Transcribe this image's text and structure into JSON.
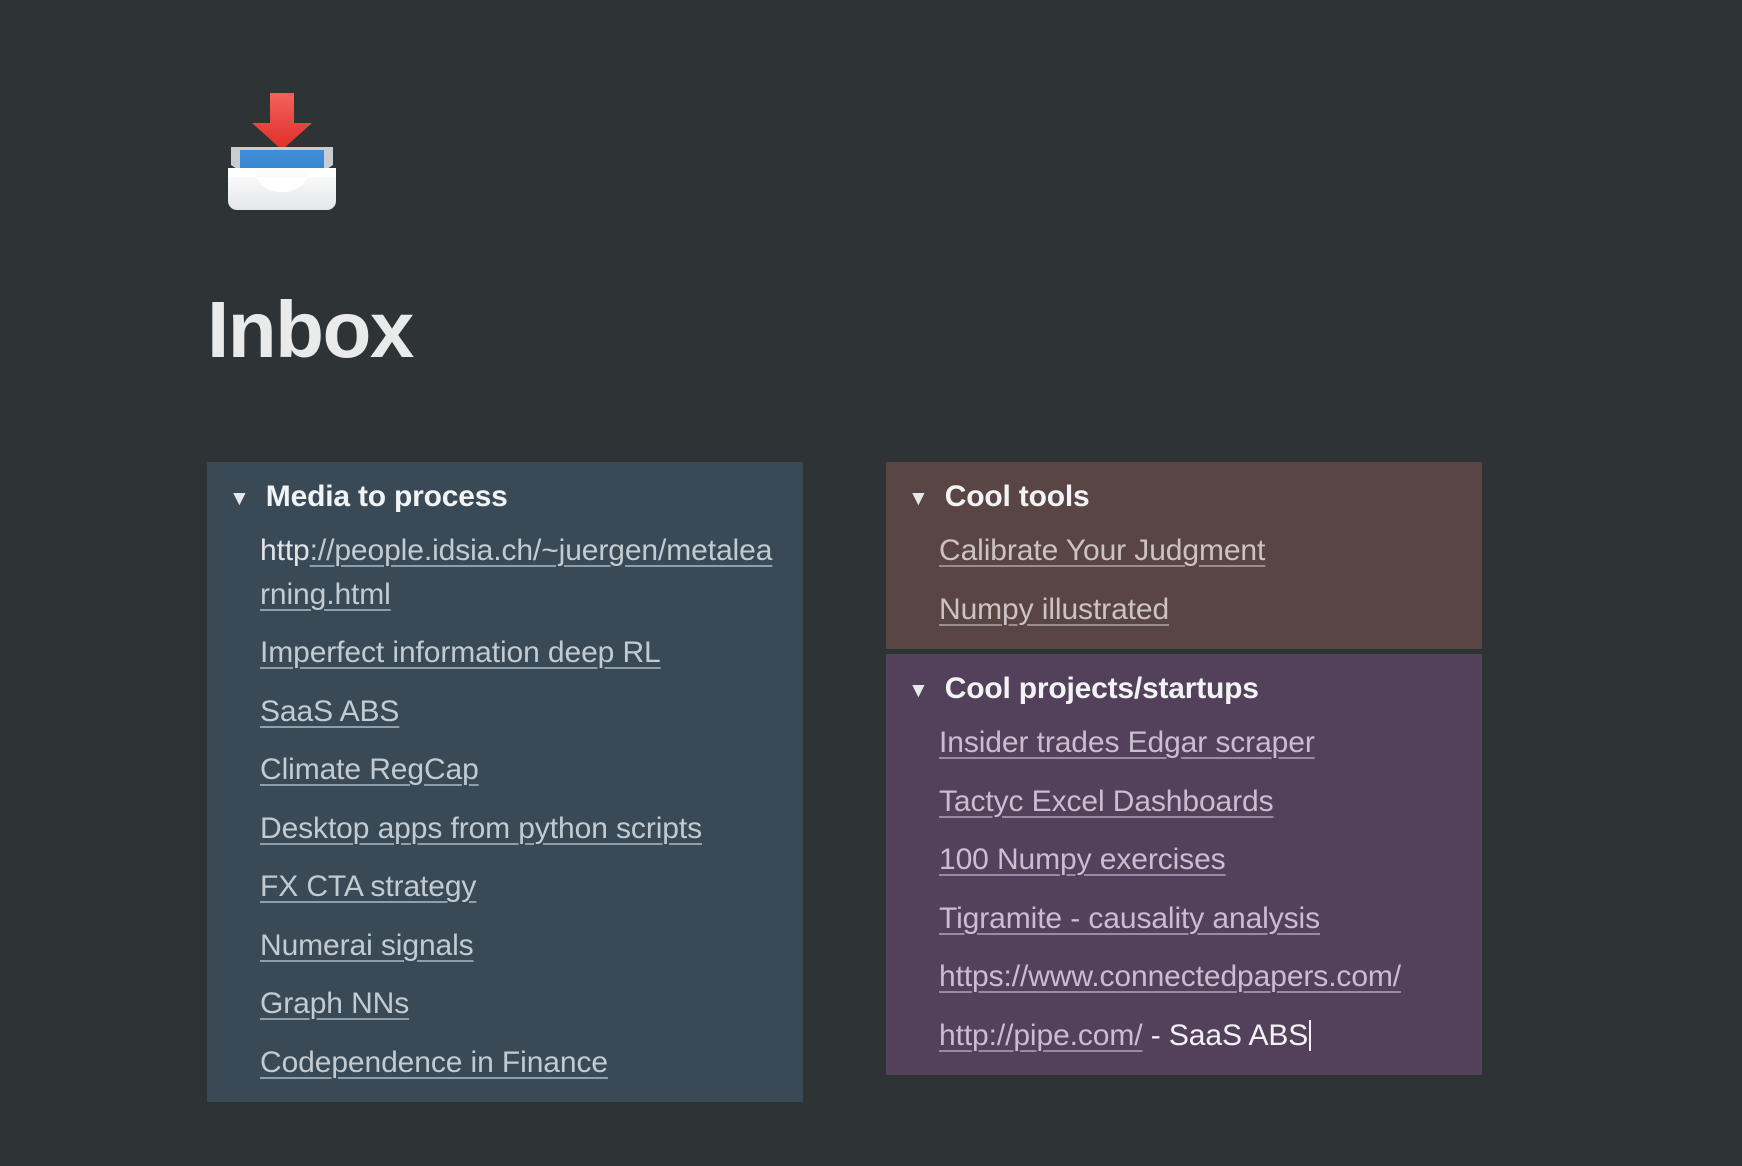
{
  "app": {
    "background_color": "#2e3336",
    "title": "Inbox",
    "icon": "inbox-tray-emoji",
    "icon_glyph": "📥"
  },
  "columns": [
    {
      "id": "left-column",
      "panels": [
        {
          "id": "media-to-process",
          "title": "Media to process",
          "twisty": "▼",
          "expanded": true,
          "color": "#394a56",
          "items": [
            {
              "prefix": "http",
              "link": "://people.idsia.ch/~juergen/metalearning.html",
              "tail": ""
            },
            {
              "prefix": "",
              "link": "Imperfect information deep RL",
              "tail": ""
            },
            {
              "prefix": "",
              "link": "SaaS ABS",
              "tail": ""
            },
            {
              "prefix": "",
              "link": "Climate RegCap",
              "tail": ""
            },
            {
              "prefix": "",
              "link": "Desktop apps from python scripts",
              "tail": ""
            },
            {
              "prefix": "",
              "link": "FX CTA strategy",
              "tail": ""
            },
            {
              "prefix": "",
              "link": "Numerai signals",
              "tail": ""
            },
            {
              "prefix": "",
              "link": "Graph NNs",
              "tail": ""
            },
            {
              "prefix": "",
              "link": "Codependence in Finance",
              "tail": ""
            }
          ]
        }
      ]
    },
    {
      "id": "right-column",
      "panels": [
        {
          "id": "cool-tools",
          "title": "Cool tools",
          "twisty": "▼",
          "expanded": true,
          "color": "#5a4545",
          "items": [
            {
              "prefix": "",
              "link": "Calibrate Your Judgment",
              "tail": ""
            },
            {
              "prefix": "",
              "link": "Numpy illustrated",
              "tail": ""
            }
          ]
        },
        {
          "id": "cool-projects-startups",
          "title": "Cool projects/startups",
          "twisty": "▼",
          "expanded": true,
          "color": "#53405a",
          "items": [
            {
              "prefix": "",
              "link": "Insider trades Edgar scraper",
              "tail": ""
            },
            {
              "prefix": "",
              "link": "Tactyc Excel Dashboards",
              "tail": ""
            },
            {
              "prefix": "",
              "link": "100 Numpy exercises",
              "tail": ""
            },
            {
              "prefix": "",
              "link": "Tigramite - causality analysis",
              "tail": ""
            },
            {
              "prefix": "",
              "link": "https://www.connectedpapers.com/",
              "tail": ""
            },
            {
              "prefix": "",
              "link": "http://pipe.com/",
              "tail": " - SaaS ABS",
              "caret": true
            }
          ]
        }
      ]
    }
  ]
}
